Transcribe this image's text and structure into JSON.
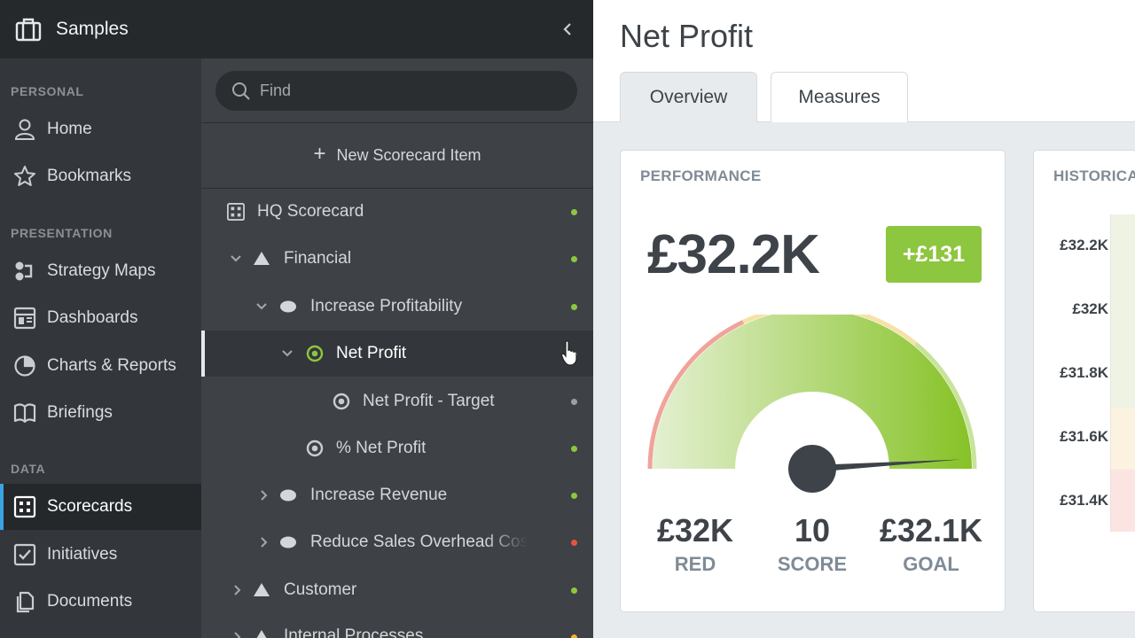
{
  "app": {
    "title": "Samples"
  },
  "nav": {
    "sections": [
      {
        "label": "PERSONAL"
      },
      {
        "label": "PRESENTATION"
      },
      {
        "label": "DATA"
      }
    ],
    "items": [
      {
        "label": "Home",
        "icon": "user-icon"
      },
      {
        "label": "Bookmarks",
        "icon": "star-icon"
      },
      {
        "label": "Strategy Maps",
        "icon": "strategy-map-icon"
      },
      {
        "label": "Dashboards",
        "icon": "dashboard-icon"
      },
      {
        "label": "Charts & Reports",
        "icon": "pie-chart-icon"
      },
      {
        "label": "Briefings",
        "icon": "book-icon"
      },
      {
        "label": "Scorecards",
        "icon": "scorecard-icon",
        "active": true
      },
      {
        "label": "Initiatives",
        "icon": "checkbox-icon"
      },
      {
        "label": "Documents",
        "icon": "documents-icon"
      }
    ]
  },
  "tree": {
    "search_placeholder": "Find",
    "new_item_label": "New Scorecard Item",
    "rows": [
      {
        "label": "HQ Scorecard",
        "status": "green"
      },
      {
        "label": "Financial",
        "status": "green"
      },
      {
        "label": "Increase Profitability",
        "status": "green"
      },
      {
        "label": "Net Profit",
        "status": "green",
        "selected": true
      },
      {
        "label": "Net Profit - Target",
        "status": "grey"
      },
      {
        "label": "% Net Profit",
        "status": "green"
      },
      {
        "label": "Increase Revenue",
        "status": "green"
      },
      {
        "label": "Reduce Sales Overhead Cost",
        "status": "red"
      },
      {
        "label": "Customer",
        "status": "green"
      },
      {
        "label": "Internal Processes",
        "status": "yellow"
      }
    ]
  },
  "main": {
    "title": "Net Profit",
    "tabs": [
      {
        "label": "Overview",
        "active": true
      },
      {
        "label": "Measures",
        "active": false
      }
    ],
    "performance": {
      "title": "PERFORMANCE",
      "value": "£32.2K",
      "delta": "+£131",
      "red": {
        "value": "£32K",
        "label": "RED"
      },
      "score": {
        "value": "10",
        "label": "SCORE"
      },
      "goal": {
        "value": "£32.1K",
        "label": "GOAL"
      },
      "score_fraction": 0.98
    },
    "historical": {
      "title": "HISTORICAL",
      "y_ticks": [
        "£32.2K",
        "£32K",
        "£31.8K",
        "£31.6K",
        "£31.4K"
      ]
    }
  },
  "colors": {
    "green": "#8dc63f",
    "red": "#e8533f",
    "yellow": "#f0b429",
    "grey": "#9aa0a6",
    "accent": "#3aa3e3"
  }
}
